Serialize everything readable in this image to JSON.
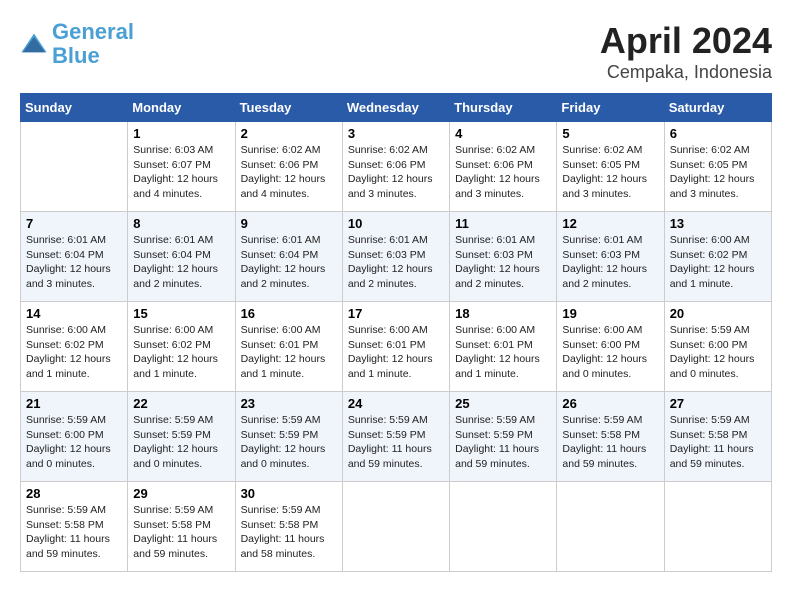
{
  "logo": {
    "line1": "General",
    "line2": "Blue"
  },
  "title": "April 2024",
  "subtitle": "Cempaka, Indonesia",
  "days_header": [
    "Sunday",
    "Monday",
    "Tuesday",
    "Wednesday",
    "Thursday",
    "Friday",
    "Saturday"
  ],
  "weeks": [
    [
      {
        "day": "",
        "info": ""
      },
      {
        "day": "1",
        "info": "Sunrise: 6:03 AM\nSunset: 6:07 PM\nDaylight: 12 hours\nand 4 minutes."
      },
      {
        "day": "2",
        "info": "Sunrise: 6:02 AM\nSunset: 6:06 PM\nDaylight: 12 hours\nand 4 minutes."
      },
      {
        "day": "3",
        "info": "Sunrise: 6:02 AM\nSunset: 6:06 PM\nDaylight: 12 hours\nand 3 minutes."
      },
      {
        "day": "4",
        "info": "Sunrise: 6:02 AM\nSunset: 6:06 PM\nDaylight: 12 hours\nand 3 minutes."
      },
      {
        "day": "5",
        "info": "Sunrise: 6:02 AM\nSunset: 6:05 PM\nDaylight: 12 hours\nand 3 minutes."
      },
      {
        "day": "6",
        "info": "Sunrise: 6:02 AM\nSunset: 6:05 PM\nDaylight: 12 hours\nand 3 minutes."
      }
    ],
    [
      {
        "day": "7",
        "info": "Sunrise: 6:01 AM\nSunset: 6:04 PM\nDaylight: 12 hours\nand 3 minutes."
      },
      {
        "day": "8",
        "info": "Sunrise: 6:01 AM\nSunset: 6:04 PM\nDaylight: 12 hours\nand 2 minutes."
      },
      {
        "day": "9",
        "info": "Sunrise: 6:01 AM\nSunset: 6:04 PM\nDaylight: 12 hours\nand 2 minutes."
      },
      {
        "day": "10",
        "info": "Sunrise: 6:01 AM\nSunset: 6:03 PM\nDaylight: 12 hours\nand 2 minutes."
      },
      {
        "day": "11",
        "info": "Sunrise: 6:01 AM\nSunset: 6:03 PM\nDaylight: 12 hours\nand 2 minutes."
      },
      {
        "day": "12",
        "info": "Sunrise: 6:01 AM\nSunset: 6:03 PM\nDaylight: 12 hours\nand 2 minutes."
      },
      {
        "day": "13",
        "info": "Sunrise: 6:00 AM\nSunset: 6:02 PM\nDaylight: 12 hours\nand 1 minute."
      }
    ],
    [
      {
        "day": "14",
        "info": "Sunrise: 6:00 AM\nSunset: 6:02 PM\nDaylight: 12 hours\nand 1 minute."
      },
      {
        "day": "15",
        "info": "Sunrise: 6:00 AM\nSunset: 6:02 PM\nDaylight: 12 hours\nand 1 minute."
      },
      {
        "day": "16",
        "info": "Sunrise: 6:00 AM\nSunset: 6:01 PM\nDaylight: 12 hours\nand 1 minute."
      },
      {
        "day": "17",
        "info": "Sunrise: 6:00 AM\nSunset: 6:01 PM\nDaylight: 12 hours\nand 1 minute."
      },
      {
        "day": "18",
        "info": "Sunrise: 6:00 AM\nSunset: 6:01 PM\nDaylight: 12 hours\nand 1 minute."
      },
      {
        "day": "19",
        "info": "Sunrise: 6:00 AM\nSunset: 6:00 PM\nDaylight: 12 hours\nand 0 minutes."
      },
      {
        "day": "20",
        "info": "Sunrise: 5:59 AM\nSunset: 6:00 PM\nDaylight: 12 hours\nand 0 minutes."
      }
    ],
    [
      {
        "day": "21",
        "info": "Sunrise: 5:59 AM\nSunset: 6:00 PM\nDaylight: 12 hours\nand 0 minutes."
      },
      {
        "day": "22",
        "info": "Sunrise: 5:59 AM\nSunset: 5:59 PM\nDaylight: 12 hours\nand 0 minutes."
      },
      {
        "day": "23",
        "info": "Sunrise: 5:59 AM\nSunset: 5:59 PM\nDaylight: 12 hours\nand 0 minutes."
      },
      {
        "day": "24",
        "info": "Sunrise: 5:59 AM\nSunset: 5:59 PM\nDaylight: 11 hours\nand 59 minutes."
      },
      {
        "day": "25",
        "info": "Sunrise: 5:59 AM\nSunset: 5:59 PM\nDaylight: 11 hours\nand 59 minutes."
      },
      {
        "day": "26",
        "info": "Sunrise: 5:59 AM\nSunset: 5:58 PM\nDaylight: 11 hours\nand 59 minutes."
      },
      {
        "day": "27",
        "info": "Sunrise: 5:59 AM\nSunset: 5:58 PM\nDaylight: 11 hours\nand 59 minutes."
      }
    ],
    [
      {
        "day": "28",
        "info": "Sunrise: 5:59 AM\nSunset: 5:58 PM\nDaylight: 11 hours\nand 59 minutes."
      },
      {
        "day": "29",
        "info": "Sunrise: 5:59 AM\nSunset: 5:58 PM\nDaylight: 11 hours\nand 59 minutes."
      },
      {
        "day": "30",
        "info": "Sunrise: 5:59 AM\nSunset: 5:58 PM\nDaylight: 11 hours\nand 58 minutes."
      },
      {
        "day": "",
        "info": ""
      },
      {
        "day": "",
        "info": ""
      },
      {
        "day": "",
        "info": ""
      },
      {
        "day": "",
        "info": ""
      }
    ]
  ]
}
